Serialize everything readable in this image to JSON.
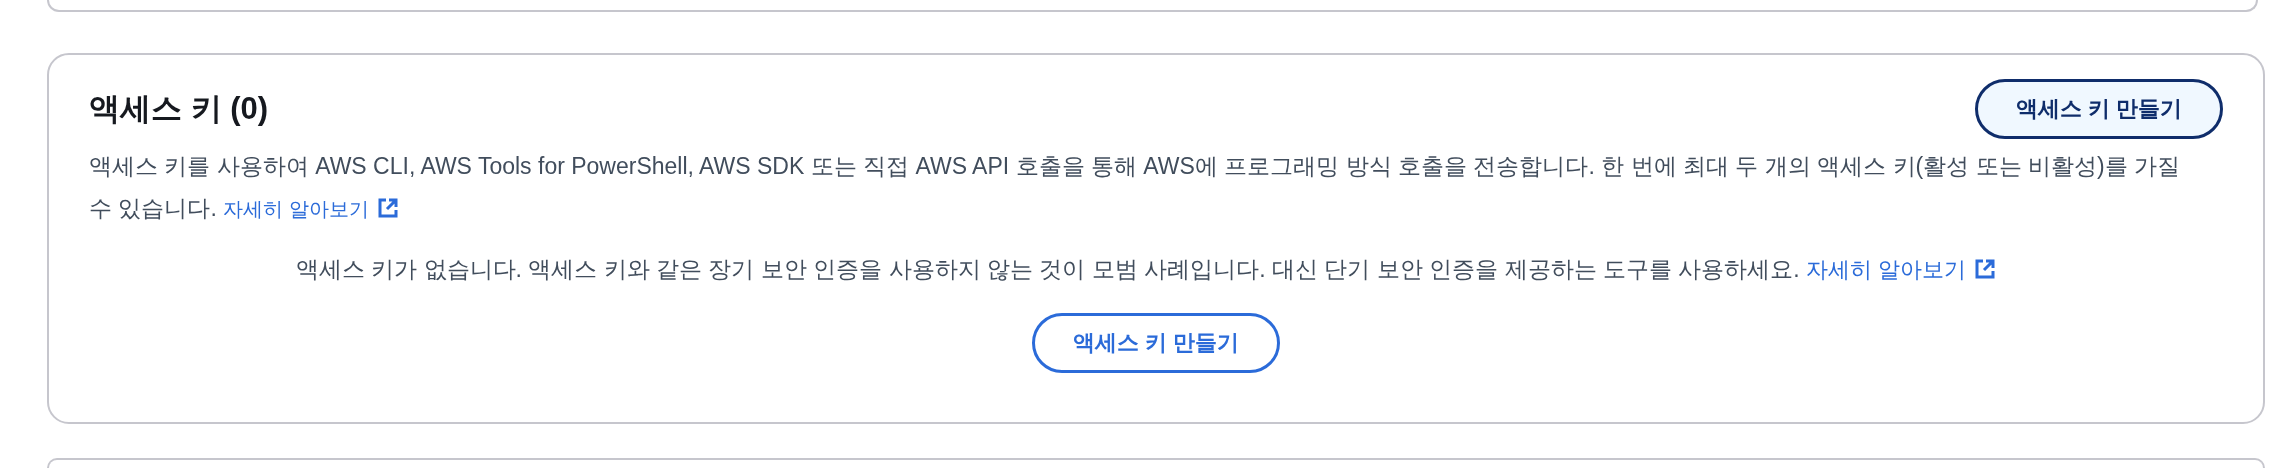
{
  "access_keys": {
    "title": "액세스 키 (0)",
    "create_button": "액세스 키 만들기",
    "description": "액세스 키를 사용하여 AWS CLI, AWS Tools for PowerShell, AWS SDK 또는 직접 AWS API 호출을 통해 AWS에 프로그래밍 방식 호출을 전송합니다. 한 번에 최대 두 개의 액세스 키(활성 또는 비활성)를 가질 수 있습니다.",
    "description_link": "자세히 알아보기",
    "empty_state": {
      "message": "액세스 키가 없습니다. 액세스 키와 같은 장기 보안 인증을 사용하지 않는 것이 모범 사례입니다. 대신 단기 보안 인증을 제공하는 도구를 사용하세요.",
      "link": "자세히 알아보기",
      "button": "액세스 키 만들기"
    }
  }
}
